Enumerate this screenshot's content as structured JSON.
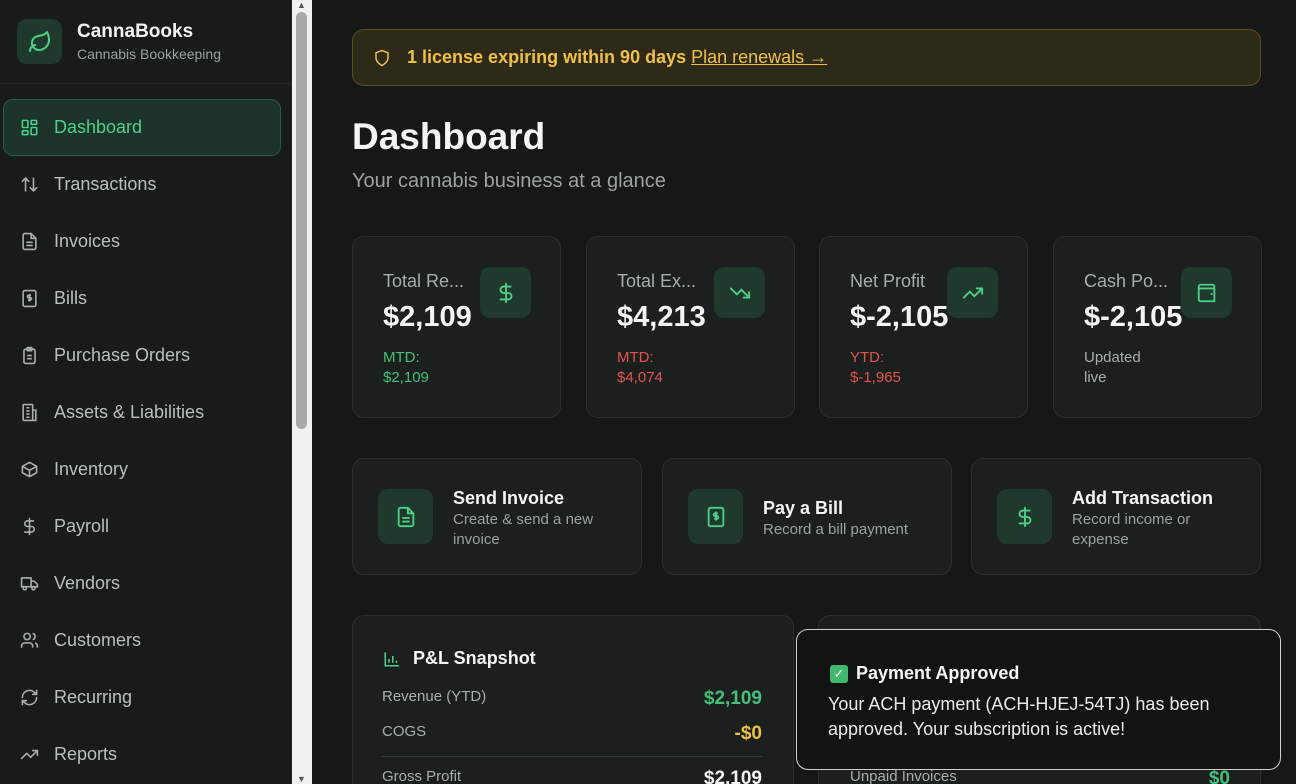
{
  "brand": {
    "name": "CannaBooks",
    "subtitle": "Cannabis Bookkeeping",
    "logo_icon": "leaf-icon"
  },
  "sidebar": {
    "items": [
      {
        "label": "Dashboard",
        "icon": "grid-icon",
        "active": true
      },
      {
        "label": "Transactions",
        "icon": "arrows-up-down-icon"
      },
      {
        "label": "Invoices",
        "icon": "document-icon"
      },
      {
        "label": "Bills",
        "icon": "receipt-icon"
      },
      {
        "label": "Purchase Orders",
        "icon": "clipboard-icon"
      },
      {
        "label": "Assets & Liabilities",
        "icon": "building-icon"
      },
      {
        "label": "Inventory",
        "icon": "box-icon"
      },
      {
        "label": "Payroll",
        "icon": "dollar-icon"
      },
      {
        "label": "Vendors",
        "icon": "truck-icon"
      },
      {
        "label": "Customers",
        "icon": "users-icon"
      },
      {
        "label": "Recurring",
        "icon": "refresh-icon"
      },
      {
        "label": "Reports",
        "icon": "trend-icon"
      }
    ]
  },
  "banner": {
    "text": "1 license expiring within 90 days",
    "link": "Plan renewals →",
    "icon": "shield-icon"
  },
  "header": {
    "title": "Dashboard",
    "subtitle": "Your cannabis business at a glance"
  },
  "stats": [
    {
      "label": "Total Re...",
      "value": "$2,109",
      "sub1": "MTD:",
      "sub2": "$2,109",
      "tone": "green",
      "icon": "dollar-icon"
    },
    {
      "label": "Total Ex...",
      "value": "$4,213",
      "sub1": "MTD:",
      "sub2": "$4,074",
      "tone": "red",
      "icon": "trend-down-icon"
    },
    {
      "label": "Net Profit",
      "value": "$-2,105",
      "sub1": "YTD:",
      "sub2": "$-1,965",
      "tone": "red",
      "icon": "trend-up-icon"
    },
    {
      "label": "Cash Po...",
      "value": "$-2,105",
      "sub1": "Updated",
      "sub2": "live",
      "tone": "grey",
      "icon": "wallet-icon"
    }
  ],
  "actions": [
    {
      "title": "Send Invoice",
      "desc": "Create & send a new invoice",
      "icon": "document-icon"
    },
    {
      "title": "Pay a Bill",
      "desc": "Record a bill payment",
      "icon": "receipt-icon"
    },
    {
      "title": "Add Transaction",
      "desc": "Record income or expense",
      "icon": "dollar-icon"
    }
  ],
  "pl": {
    "title": "P&L Snapshot",
    "rows": [
      {
        "label": "Revenue (YTD)",
        "value": "$2,109"
      },
      {
        "label": "COGS",
        "value": "-$0"
      },
      {
        "label": "Gross Profit",
        "value": "$2,109"
      }
    ]
  },
  "panel2": {
    "row_label": "Unpaid Invoices",
    "row_value": "$0"
  },
  "toast": {
    "title": "Payment Approved",
    "body": "Your ACH payment (ACH-HJEJ-54TJ) has been approved. Your subscription is active!"
  },
  "colors": {
    "accent": "#4fd08a",
    "warning": "#f0c046",
    "danger": "#e5534b"
  }
}
